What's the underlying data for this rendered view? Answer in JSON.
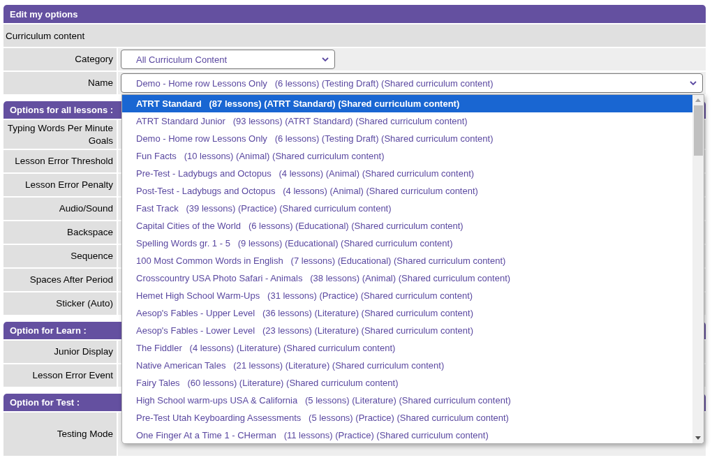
{
  "title": "Edit my options",
  "curriculum": {
    "heading": "Curriculum content",
    "fields": [
      {
        "label": "Category",
        "value": "All Curriculum Content",
        "kind": "short"
      },
      {
        "label": "Name",
        "value": "Demo - Home row Lessons Only   (6 lessons) (Testing Draft) (Shared curriculum content)",
        "kind": "wide"
      }
    ]
  },
  "sections": [
    {
      "title": "Options for all lessons :",
      "rows": [
        {
          "label": "Typing Words Per Minute Goals",
          "kind": "tall"
        },
        {
          "label": "Lesson Error Threshold",
          "kind": "normal"
        },
        {
          "label": "Lesson Error Penalty",
          "kind": "normal"
        },
        {
          "label": "Audio/Sound",
          "kind": "normal"
        },
        {
          "label": "Backspace",
          "kind": "normal"
        },
        {
          "label": "Sequence",
          "kind": "normal"
        },
        {
          "label": "Spaces After Period",
          "kind": "normal"
        },
        {
          "label": "Sticker (Auto)",
          "kind": "normal"
        }
      ]
    },
    {
      "title": "Option for Learn :",
      "rows": [
        {
          "label": "Junior Display",
          "kind": "normal"
        },
        {
          "label": "Lesson Error Event",
          "kind": "normal"
        }
      ]
    },
    {
      "title": "Option for Test :",
      "rows": [
        {
          "label": "Testing Mode",
          "kind": "double"
        }
      ]
    }
  ],
  "dropdown": {
    "options": [
      {
        "label": "ATRT Standard   (87 lessons) (ATRT Standard) (Shared curriculum content)",
        "selected": true
      },
      {
        "label": "ATRT Standard Junior   (93 lessons) (ATRT Standard) (Shared curriculum content)",
        "selected": false
      },
      {
        "label": "Demo - Home row Lessons Only   (6 lessons) (Testing Draft) (Shared curriculum content)",
        "selected": false
      },
      {
        "label": "Fun Facts   (10 lessons) (Animal) (Shared curriculum content)",
        "selected": false
      },
      {
        "label": "Pre-Test - Ladybugs and Octopus   (4 lessons) (Animal) (Shared curriculum content)",
        "selected": false
      },
      {
        "label": "Post-Test - Ladybugs and Octopus   (4 lessons) (Animal) (Shared curriculum content)",
        "selected": false
      },
      {
        "label": "Fast Track   (39 lessons) (Practice) (Shared curriculum content)",
        "selected": false
      },
      {
        "label": "Capital Cities of the World   (6 lessons) (Educational) (Shared curriculum content)",
        "selected": false
      },
      {
        "label": "Spelling Words gr. 1 - 5   (9 lessons) (Educational) (Shared curriculum content)",
        "selected": false
      },
      {
        "label": "100 Most Common Words in English   (7 lessons) (Educational) (Shared curriculum content)",
        "selected": false
      },
      {
        "label": "Crosscountry USA Photo Safari - Animals   (38 lessons) (Animal) (Shared curriculum content)",
        "selected": false
      },
      {
        "label": "Hemet High School Warm-Ups   (31 lessons) (Practice) (Shared curriculum content)",
        "selected": false
      },
      {
        "label": "Aesop's Fables - Upper Level   (36 lessons) (Literature) (Shared curriculum content)",
        "selected": false
      },
      {
        "label": "Aesop's Fables - Lower Level   (23 lessons) (Literature) (Shared curriculum content)",
        "selected": false
      },
      {
        "label": "The Fiddler   (4 lessons) (Literature) (Shared curriculum content)",
        "selected": false
      },
      {
        "label": "Native American Tales   (21 lessons) (Literature) (Shared curriculum content)",
        "selected": false
      },
      {
        "label": "Fairy Tales   (60 lessons) (Literature) (Shared curriculum content)",
        "selected": false
      },
      {
        "label": "High School warm-ups USA & California   (5 lessons) (Literature) (Shared curriculum content)",
        "selected": false
      },
      {
        "label": "Pre-Test Utah Keyboarding Assessments   (5 lessons) (Practice) (Shared curriculum content)",
        "selected": false
      },
      {
        "label": "One Finger At a Time 1 - CHerman   (11 lessons) (Practice) (Shared curriculum content)",
        "selected": false
      }
    ]
  }
}
